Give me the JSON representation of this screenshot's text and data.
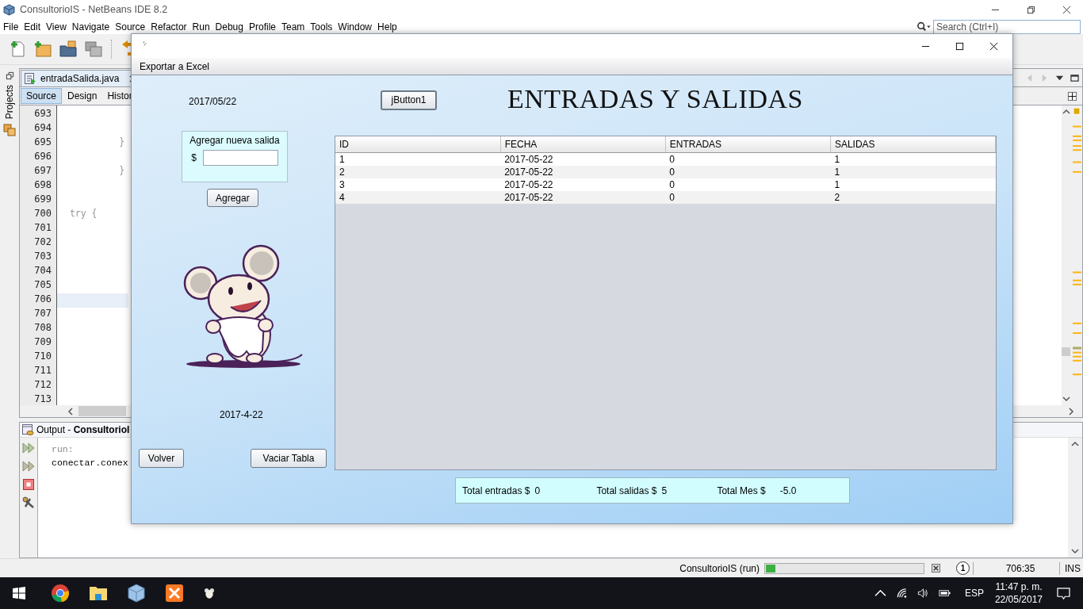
{
  "ide": {
    "title": "ConsultorioIS - NetBeans IDE 8.2",
    "menu": [
      "File",
      "Edit",
      "View",
      "Navigate",
      "Source",
      "Refactor",
      "Run",
      "Debug",
      "Profile",
      "Team",
      "Tools",
      "Window",
      "Help"
    ],
    "search": {
      "placeholder": "Search (Ctrl+I)"
    },
    "side_tab": "Projects",
    "editor": {
      "file_tab": "entradaSalida.java",
      "view_tabs": [
        {
          "label": "Source",
          "selected": true
        },
        {
          "label": "Design",
          "selected": false
        },
        {
          "label": "Histor",
          "selected": false
        }
      ],
      "lines": [
        {
          "number": "693",
          "current": false
        },
        {
          "number": "694",
          "current": false
        },
        {
          "number": "695",
          "code": "          }",
          "current": false
        },
        {
          "number": "696",
          "current": false
        },
        {
          "number": "697",
          "code": "          }",
          "current": false
        },
        {
          "number": "698",
          "current": false
        },
        {
          "number": "699",
          "current": false
        },
        {
          "number": "700",
          "code": " try {",
          "current": false
        },
        {
          "number": "701",
          "current": false
        },
        {
          "number": "702",
          "current": false
        },
        {
          "number": "703",
          "current": false
        },
        {
          "number": "704",
          "current": false
        },
        {
          "number": "705",
          "current": false
        },
        {
          "number": "706",
          "current": true
        },
        {
          "number": "707",
          "current": false
        },
        {
          "number": "708",
          "current": false
        },
        {
          "number": "709",
          "current": false
        },
        {
          "number": "710",
          "current": false
        },
        {
          "number": "711",
          "current": false
        },
        {
          "number": "712",
          "current": false
        },
        {
          "number": "713",
          "current": false
        }
      ]
    },
    "output": {
      "title": "Output - **ConsultorioI**",
      "lines": [
        {
          "text": "run:",
          "kind": "info"
        },
        {
          "text": "conectar.conex",
          "kind": "plain"
        }
      ]
    },
    "status_bar": {
      "task": "ConsultorioIS (run)",
      "progress": {
        "level": 0.06
      },
      "notifications": "1",
      "position": "706:35",
      "mode": "INS"
    }
  },
  "dialog": {
    "menu": [
      "Exportar a Excel"
    ],
    "date_top": "2017/05/22",
    "top_button": "jButton1",
    "heading": "ENTRADAS Y SALIDAS",
    "add_panel": {
      "title": "Agregar nueva salida",
      "currency": "$"
    },
    "add_button": "Agregar",
    "date_bottom": "2017-4-22",
    "buttons": [
      "Volver",
      "Vaciar Tabla"
    ],
    "table": {
      "columns": [
        "ID",
        "FECHA",
        "ENTRADAS",
        "SALIDAS"
      ],
      "rows": [
        [
          "1",
          "2017-05-22",
          "0",
          "1"
        ],
        [
          "2",
          "2017-05-22",
          "0",
          "1"
        ],
        [
          "3",
          "2017-05-22",
          "0",
          "1"
        ],
        [
          "4",
          "2017-05-22",
          "0",
          "2"
        ]
      ]
    },
    "totals": [
      {
        "label": "Total entradas $",
        "value": "0"
      },
      {
        "label": "Total salidas $",
        "value": "5"
      },
      {
        "label": "Total Mes $",
        "value": "-5.0"
      }
    ]
  },
  "taskbar": {
    "language": "ESP",
    "time": "11:47 p. m.",
    "date": "22/05/2017"
  }
}
